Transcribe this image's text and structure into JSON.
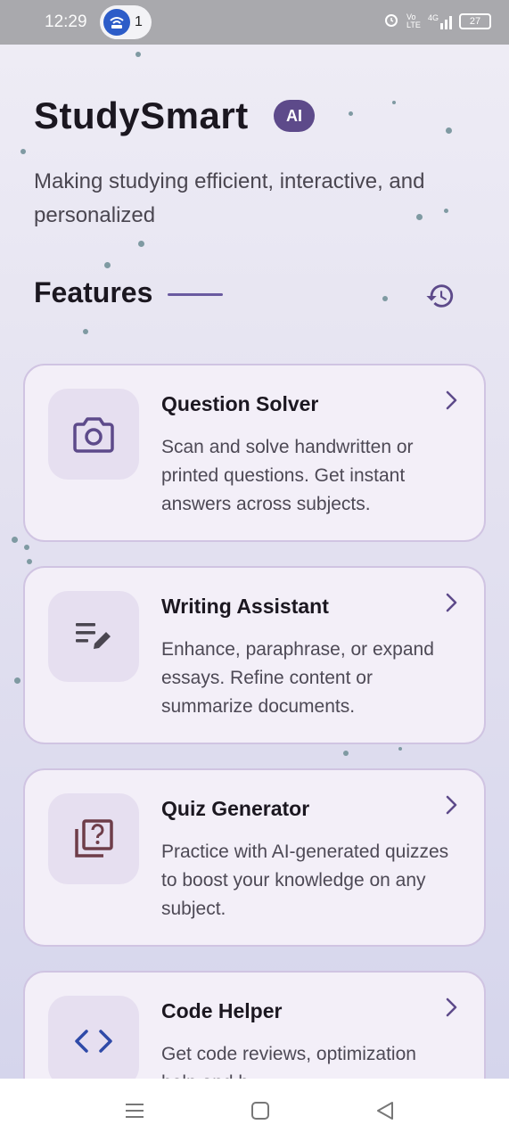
{
  "status_bar": {
    "time": "12:29",
    "hotspot_count": "1",
    "network_label": "Vo LTE",
    "signal_label": "4G",
    "battery": "27",
    "icons": [
      "hotspot-icon",
      "alarm-icon",
      "volte-icon",
      "signal-icon",
      "battery-icon"
    ]
  },
  "header": {
    "title": "StudySmart",
    "badge": "AI",
    "subtitle": "Making studying efficient, interactive, and personalized"
  },
  "features": {
    "heading": "Features",
    "history_icon": "history-icon",
    "cards": [
      {
        "title": "Question Solver",
        "description": "Scan and solve handwritten or printed questions. Get instant answers across subjects.",
        "icon": "camera-icon",
        "icon_color": "#5d4a8a"
      },
      {
        "title": "Writing Assistant",
        "description": "Enhance, paraphrase, or expand essays. Refine content or summarize documents.",
        "icon": "edit-note-icon",
        "icon_color": "#4a4650"
      },
      {
        "title": "Quiz Generator",
        "description": "Practice with AI-generated quizzes to boost your knowledge on any subject.",
        "icon": "quiz-icon",
        "icon_color": "#6e3d49"
      },
      {
        "title": "Code Helper",
        "description": "Get code reviews, optimization help and b",
        "icon": "code-icon",
        "icon_color": "#2f4aa8"
      }
    ]
  },
  "colors": {
    "accent": "#5d4a8a",
    "card_background": "#f3eff8",
    "card_border": "#d0c4e2",
    "status_bar": "#a9a9ad"
  },
  "nav_bar": {
    "icons": [
      "menu-icon",
      "home-icon",
      "back-icon"
    ]
  }
}
